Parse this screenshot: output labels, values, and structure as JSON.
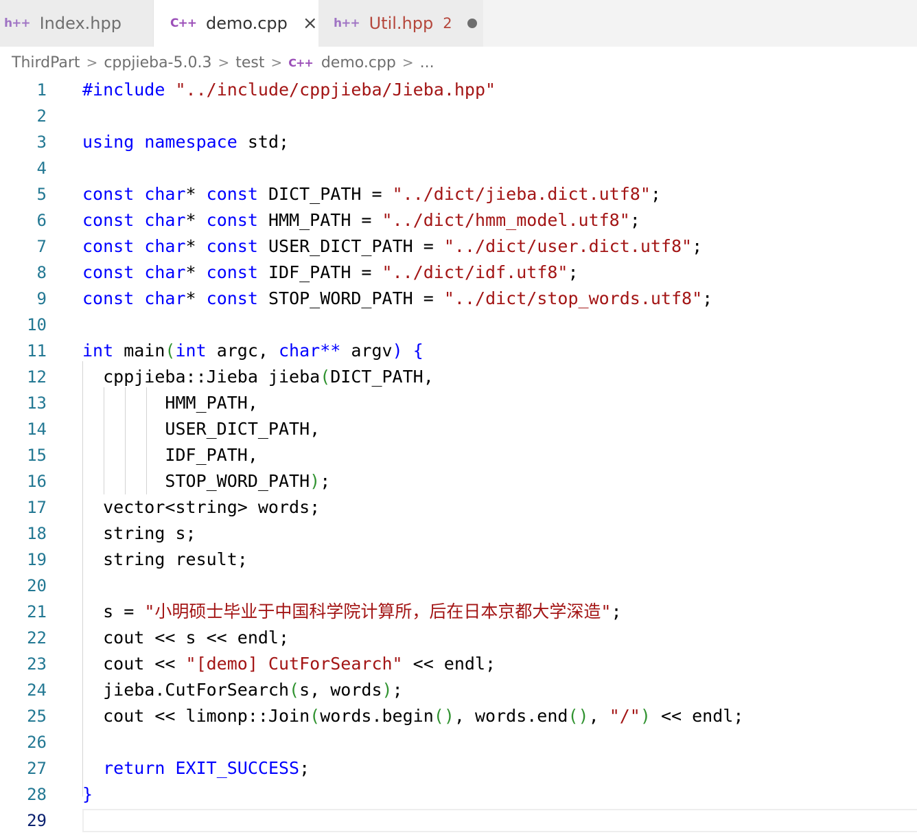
{
  "tabs": [
    {
      "icon": "h++",
      "label": "Index.hpp"
    },
    {
      "icon": "C++",
      "label": "demo.cpp",
      "close": "×"
    },
    {
      "icon": "h++",
      "label": "Util.hpp",
      "problems": "2"
    }
  ],
  "breadcrumb": {
    "items": [
      "ThirdPart",
      "cppjieba-5.0.3",
      "test",
      "demo.cpp",
      "..."
    ],
    "file_icon": "C++",
    "separator": ">"
  },
  "editor": {
    "current_line": 29,
    "lines": [
      {
        "n": "1",
        "tokens": [
          {
            "t": "#include",
            "c": "pp"
          },
          {
            "t": " "
          },
          {
            "t": "\"../include/cppjieba/Jieba.hpp\"",
            "c": "str"
          }
        ]
      },
      {
        "n": "2",
        "tokens": []
      },
      {
        "n": "3",
        "tokens": [
          {
            "t": "using",
            "c": "kw"
          },
          {
            "t": " "
          },
          {
            "t": "namespace",
            "c": "kw"
          },
          {
            "t": " std;"
          }
        ]
      },
      {
        "n": "4",
        "tokens": []
      },
      {
        "n": "5",
        "tokens": [
          {
            "t": "const",
            "c": "kw"
          },
          {
            "t": " "
          },
          {
            "t": "char",
            "c": "kw"
          },
          {
            "t": "* "
          },
          {
            "t": "const",
            "c": "kw"
          },
          {
            "t": " DICT_PATH = "
          },
          {
            "t": "\"../dict/jieba.dict.utf8\"",
            "c": "str"
          },
          {
            "t": ";"
          }
        ]
      },
      {
        "n": "6",
        "tokens": [
          {
            "t": "const",
            "c": "kw"
          },
          {
            "t": " "
          },
          {
            "t": "char",
            "c": "kw"
          },
          {
            "t": "* "
          },
          {
            "t": "const",
            "c": "kw"
          },
          {
            "t": " HMM_PATH = "
          },
          {
            "t": "\"../dict/hmm_model.utf8\"",
            "c": "str"
          },
          {
            "t": ";"
          }
        ]
      },
      {
        "n": "7",
        "tokens": [
          {
            "t": "const",
            "c": "kw"
          },
          {
            "t": " "
          },
          {
            "t": "char",
            "c": "kw"
          },
          {
            "t": "* "
          },
          {
            "t": "const",
            "c": "kw"
          },
          {
            "t": " USER_DICT_PATH = "
          },
          {
            "t": "\"../dict/user.dict.utf8\"",
            "c": "str"
          },
          {
            "t": ";"
          }
        ]
      },
      {
        "n": "8",
        "tokens": [
          {
            "t": "const",
            "c": "kw"
          },
          {
            "t": " "
          },
          {
            "t": "char",
            "c": "kw"
          },
          {
            "t": "* "
          },
          {
            "t": "const",
            "c": "kw"
          },
          {
            "t": " IDF_PATH = "
          },
          {
            "t": "\"../dict/idf.utf8\"",
            "c": "str"
          },
          {
            "t": ";"
          }
        ]
      },
      {
        "n": "9",
        "tokens": [
          {
            "t": "const",
            "c": "kw"
          },
          {
            "t": " "
          },
          {
            "t": "char",
            "c": "kw"
          },
          {
            "t": "* "
          },
          {
            "t": "const",
            "c": "kw"
          },
          {
            "t": " STOP_WORD_PATH = "
          },
          {
            "t": "\"../dict/stop_words.utf8\"",
            "c": "str"
          },
          {
            "t": ";"
          }
        ]
      },
      {
        "n": "10",
        "tokens": []
      },
      {
        "n": "11",
        "tokens": [
          {
            "t": "int",
            "c": "kw"
          },
          {
            "t": " main"
          },
          {
            "t": "(",
            "c": "br"
          },
          {
            "t": "int",
            "c": "kw"
          },
          {
            "t": " argc, "
          },
          {
            "t": "char",
            "c": "kw"
          },
          {
            "t": "** ",
            "c": "kw"
          },
          {
            "t": "argv"
          },
          {
            "t": ")",
            "c": "kw"
          },
          {
            "t": " "
          },
          {
            "t": "{",
            "c": "kw"
          }
        ]
      },
      {
        "n": "12",
        "tokens": [
          {
            "t": "  cppjieba::Jieba jieba"
          },
          {
            "t": "(",
            "c": "br"
          },
          {
            "t": "DICT_PATH,"
          }
        ]
      },
      {
        "n": "13",
        "tokens": [
          {
            "t": "        HMM_PATH,"
          }
        ]
      },
      {
        "n": "14",
        "tokens": [
          {
            "t": "        USER_DICT_PATH,"
          }
        ]
      },
      {
        "n": "15",
        "tokens": [
          {
            "t": "        IDF_PATH,"
          }
        ]
      },
      {
        "n": "16",
        "tokens": [
          {
            "t": "        STOP_WORD_PATH"
          },
          {
            "t": ")",
            "c": "br"
          },
          {
            "t": ";"
          }
        ]
      },
      {
        "n": "17",
        "tokens": [
          {
            "t": "  vector<string> words;"
          }
        ]
      },
      {
        "n": "18",
        "tokens": [
          {
            "t": "  string s;"
          }
        ]
      },
      {
        "n": "19",
        "tokens": [
          {
            "t": "  string result;"
          }
        ]
      },
      {
        "n": "20",
        "tokens": []
      },
      {
        "n": "21",
        "tokens": [
          {
            "t": "  s = "
          },
          {
            "t": "\"",
            "c": "str"
          },
          {
            "t": "小明硕士毕业于中国科学院计算所，后在日本京都大学深造",
            "c": "strcn"
          },
          {
            "t": "\"",
            "c": "str"
          },
          {
            "t": ";"
          }
        ]
      },
      {
        "n": "22",
        "tokens": [
          {
            "t": "  cout << s << endl;"
          }
        ]
      },
      {
        "n": "23",
        "tokens": [
          {
            "t": "  cout << "
          },
          {
            "t": "\"[demo] CutForSearch\"",
            "c": "str"
          },
          {
            "t": " << endl;"
          }
        ]
      },
      {
        "n": "24",
        "tokens": [
          {
            "t": "  jieba.CutForSearch"
          },
          {
            "t": "(",
            "c": "br"
          },
          {
            "t": "s, words"
          },
          {
            "t": ")",
            "c": "br"
          },
          {
            "t": ";"
          }
        ]
      },
      {
        "n": "25",
        "tokens": [
          {
            "t": "  cout << limonp::Join"
          },
          {
            "t": "(",
            "c": "br"
          },
          {
            "t": "words.begin"
          },
          {
            "t": "()",
            "c": "br"
          },
          {
            "t": ", words.end"
          },
          {
            "t": "()",
            "c": "br"
          },
          {
            "t": ", "
          },
          {
            "t": "\"/\"",
            "c": "str"
          },
          {
            "t": ")",
            "c": "br"
          },
          {
            "t": " << endl;"
          }
        ]
      },
      {
        "n": "26",
        "tokens": []
      },
      {
        "n": "27",
        "tokens": [
          {
            "t": "  "
          },
          {
            "t": "return",
            "c": "kw"
          },
          {
            "t": " "
          },
          {
            "t": "EXIT_SUCCESS",
            "c": "kw"
          },
          {
            "t": ";"
          }
        ]
      },
      {
        "n": "28",
        "tokens": [
          {
            "t": "}",
            "c": "kw"
          }
        ]
      },
      {
        "n": "29",
        "tokens": []
      }
    ]
  }
}
